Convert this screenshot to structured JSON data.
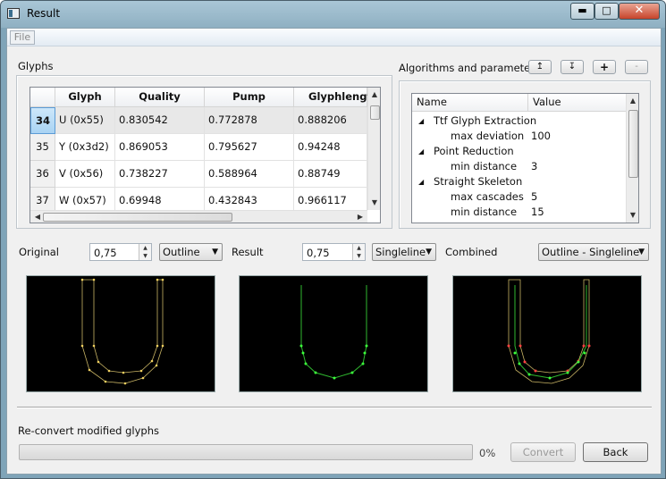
{
  "window": {
    "title": "Result",
    "minimize": "▬",
    "maximize": "□",
    "close": "✕"
  },
  "menu": {
    "file": "File"
  },
  "glyphs": {
    "label": "Glyphs",
    "columns": [
      "Glyph",
      "Quality",
      "Pump",
      "Glyphlengtl"
    ],
    "rows": [
      {
        "id": "34",
        "glyph": "U (0x55)",
        "quality": "0.830542",
        "pump": "0.772878",
        "length": "0.888206"
      },
      {
        "id": "35",
        "glyph": "Y (0x3d2)",
        "quality": "0.869053",
        "pump": "0.795627",
        "length": "0.94248"
      },
      {
        "id": "36",
        "glyph": "V (0x56)",
        "quality": "0.738227",
        "pump": "0.588964",
        "length": "0.88749"
      },
      {
        "id": "37",
        "glyph": "W (0x57)",
        "quality": "0.69948",
        "pump": "0.432843",
        "length": "0.966117"
      }
    ]
  },
  "algorithms": {
    "label": "Algorithms and parameters",
    "buttons": {
      "up": "↥",
      "down": "↧",
      "add": "+",
      "remove": "-"
    },
    "columns": [
      "Name",
      "Value"
    ],
    "items": [
      {
        "name": "Ttf Glyph Extraction",
        "value": "",
        "level": 0
      },
      {
        "name": "max deviation",
        "value": "100",
        "level": 1
      },
      {
        "name": "Point Reduction",
        "value": "",
        "level": 0
      },
      {
        "name": "min distance",
        "value": "3",
        "level": 1
      },
      {
        "name": "Straight Skeleton",
        "value": "",
        "level": 0
      },
      {
        "name": "max cascades",
        "value": "5",
        "level": 1
      },
      {
        "name": "min distance",
        "value": "15",
        "level": 1
      }
    ]
  },
  "views": {
    "original": {
      "label": "Original",
      "zoom": "0,75",
      "mode": "Outline"
    },
    "result": {
      "label": "Result",
      "zoom": "0,75",
      "mode": "Singleline"
    },
    "combined": {
      "label": "Combined",
      "mode": "Outline - Singleline"
    }
  },
  "footer": {
    "label": "Re-convert modified glyphs",
    "progress": 0,
    "progress_text": "0%",
    "convert": "Convert",
    "back": "Back"
  },
  "colors": {
    "outline": "#c8b464",
    "singleline": "#2fb82f",
    "point_outline": "#f0d060",
    "point_single": "#3cff3c",
    "point_combined": "#ff4040"
  }
}
